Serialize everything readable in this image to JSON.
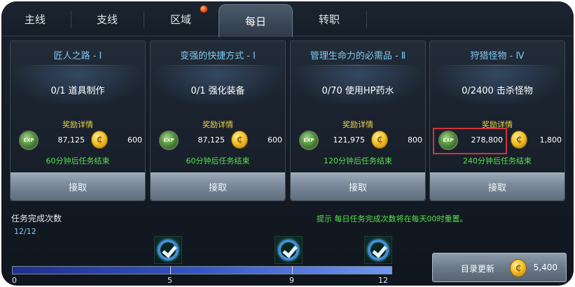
{
  "tabs": [
    {
      "label": "主线"
    },
    {
      "label": "支线"
    },
    {
      "label": "区域"
    },
    {
      "label": "每日"
    },
    {
      "label": "转职"
    }
  ],
  "cards": [
    {
      "title": "匠人之路 - Ⅰ",
      "progress": "0/1 道具制作",
      "reward_title": "奖励详情",
      "exp_icon_text": "EXP",
      "exp": "87,125",
      "coin_icon_text": "₵",
      "coins": "600",
      "timer": "60分钟后任务结束",
      "button": "接取"
    },
    {
      "title": "变强的快捷方式 - Ⅰ",
      "progress": "0/1 强化装备",
      "reward_title": "奖励详情",
      "exp_icon_text": "EXP",
      "exp": "87,125",
      "coin_icon_text": "₵",
      "coins": "600",
      "timer": "60分钟后任务结束",
      "button": "接取"
    },
    {
      "title": "管理生命力的必需品 - Ⅱ",
      "progress": "0/70 使用HP药水",
      "reward_title": "奖励详情",
      "exp_icon_text": "EXP",
      "exp": "121,975",
      "coin_icon_text": "₵",
      "coins": "800",
      "timer": "120分钟后任务结束",
      "button": "接取"
    },
    {
      "title": "狩猎怪物 - Ⅳ",
      "progress": "0/2400 击杀怪物",
      "reward_title": "奖励详情",
      "exp_icon_text": "EXP",
      "exp": "278,800",
      "coin_icon_text": "₵",
      "coins": "1,800",
      "timer": "240分钟后任务结束",
      "button": "接取"
    }
  ],
  "completion": {
    "label": "任务完成次数",
    "count": "12/12",
    "progress": 1.0,
    "ticks": [
      "0",
      "5",
      "9",
      "12"
    ]
  },
  "tip": "提示 每日任务完成次数将在每天00时重置。",
  "refresh": {
    "label": "目录更新",
    "coin_icon_text": "₵",
    "cost": "5,400"
  },
  "colors": {
    "accent_title": "#7ec9f2",
    "green_text": "#56e04c",
    "gold_text": "#f1d54b",
    "highlight": "#d0343a"
  }
}
